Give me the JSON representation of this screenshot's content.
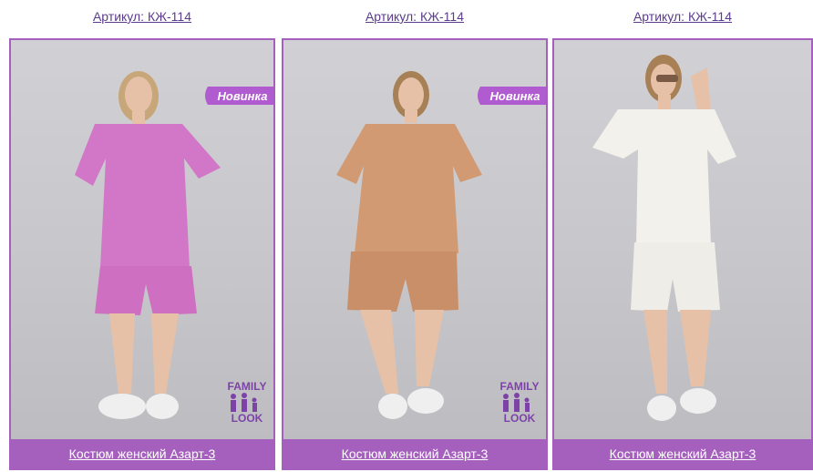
{
  "products": [
    {
      "sku": "Артикул: КЖ-114",
      "name": "Костюм женский Азарт-3",
      "badge": "Новинка",
      "family_look": {
        "top": "FAMILY",
        "bottom": "LOOK"
      },
      "colors": {
        "top": "#d277c8",
        "shorts": "#cf6fc2",
        "skin": "#e6c1a8",
        "hair": "#c7a679",
        "shoes": "#efefef"
      }
    },
    {
      "sku": "Артикул: КЖ-114",
      "name": "Костюм женский Азарт-3",
      "badge": "Новинка",
      "family_look": {
        "top": "FAMILY",
        "bottom": "LOOK"
      },
      "colors": {
        "top": "#d19a73",
        "shorts": "#c98f68",
        "skin": "#e6c1a8",
        "hair": "#a88056",
        "shoes": "#efefef"
      }
    },
    {
      "sku": "Артикул: КЖ-114",
      "name": "Костюм женский Азарт-3",
      "colors": {
        "top": "#f3f1ec",
        "shorts": "#efede8",
        "skin": "#e6c1a8",
        "hair": "#a88056",
        "shoes": "#efefef"
      }
    }
  ],
  "theme": {
    "accent": "#a55fbd",
    "link": "#5b3b8c",
    "logo": "#7d42a8"
  }
}
